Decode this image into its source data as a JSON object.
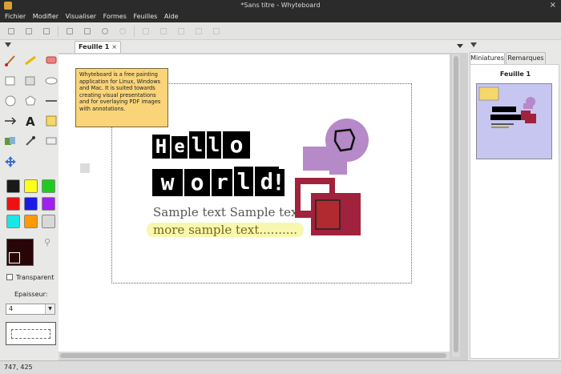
{
  "window": {
    "title": "*Sans titre - Whyteboard"
  },
  "menu": [
    "Fichier",
    "Modifier",
    "Visualiser",
    "Formes",
    "Feuilles",
    "Aide"
  ],
  "toolbar": {
    "icons": [
      "new",
      "open",
      "save",
      "copy",
      "paste",
      "undo",
      "redo",
      "delete",
      "move-up",
      "move-down",
      "to-top",
      "to-bottom"
    ]
  },
  "palette": {
    "colors": [
      "#1a1a1a",
      "#ffff1a",
      "#1ecc1e",
      "#ee1111",
      "#1a1ae6",
      "#a020f0",
      "#1ae6e6",
      "#ff9900",
      "#d8d8d8"
    ],
    "current": "#2a0508"
  },
  "options": {
    "transparent_label": "Transparent",
    "thickness_label": "Epaisseur:",
    "thickness_value": "4"
  },
  "tabs": {
    "active": "Feuille 1",
    "close": "×"
  },
  "canvas": {
    "note": "Whyteboard is a free painting application for Linux, Windows and Mac. It is suited towards creating visual presentations and for overlaying PDF images with annotations.",
    "hello": [
      "H",
      "e",
      "l",
      "l",
      "o"
    ],
    "world": [
      "w",
      "o",
      "r",
      "l",
      "d"
    ],
    "bang": "!",
    "sample1": "Sample text Sample text",
    "sample2": "more sample text..........",
    "accent_colors": {
      "purple": "#b689c8",
      "crimson": "#a0223c",
      "dark_red": "#b02a30"
    }
  },
  "right_panel": {
    "tabs": [
      "Miniatures",
      "Remarques"
    ],
    "thumb_title": "Feuille 1"
  },
  "status": {
    "coords": "747, 425"
  }
}
